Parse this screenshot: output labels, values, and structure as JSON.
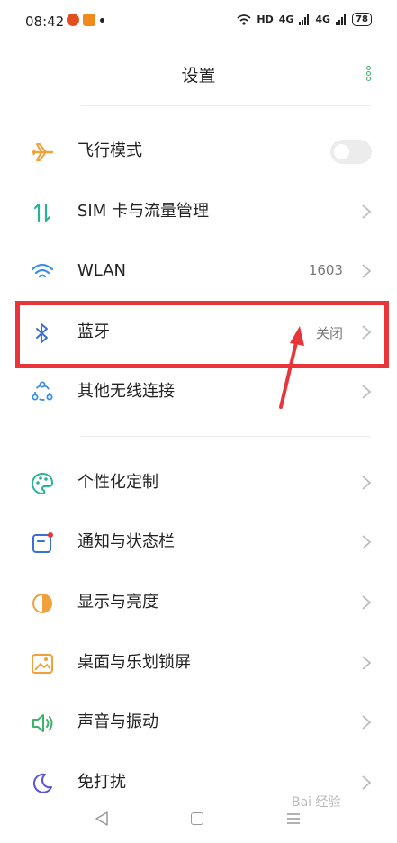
{
  "status_bar": {
    "time": "08:42",
    "network_label": "HD",
    "signal1": "4G",
    "signal2": "4G",
    "battery": "78"
  },
  "header": {
    "title": "设置"
  },
  "rows": [
    {
      "label": "飞行模式",
      "value": "",
      "icon": "airplane-icon"
    },
    {
      "label": "SIM 卡与流量管理",
      "value": "",
      "icon": "sim-data-icon"
    },
    {
      "label": "WLAN",
      "value": "1603",
      "icon": "wifi-icon"
    },
    {
      "label": "蓝牙",
      "value": "关闭",
      "icon": "bluetooth-icon"
    },
    {
      "label": "其他无线连接",
      "value": "",
      "icon": "wireless-connections-icon"
    },
    {
      "label": "个性化定制",
      "value": "",
      "icon": "palette-icon"
    },
    {
      "label": "通知与状态栏",
      "value": "",
      "icon": "notification-icon"
    },
    {
      "label": "显示与亮度",
      "value": "",
      "icon": "brightness-icon"
    },
    {
      "label": "桌面与乐划锁屏",
      "value": "",
      "icon": "wallpaper-icon"
    },
    {
      "label": "声音与振动",
      "value": "",
      "icon": "speaker-icon"
    },
    {
      "label": "免打扰",
      "value": "",
      "icon": "moon-icon"
    }
  ],
  "airplane_mode_on": false,
  "colors": {
    "accent": "#3fb06a",
    "highlight": "#e8353a"
  },
  "watermark": "Bai 经验"
}
